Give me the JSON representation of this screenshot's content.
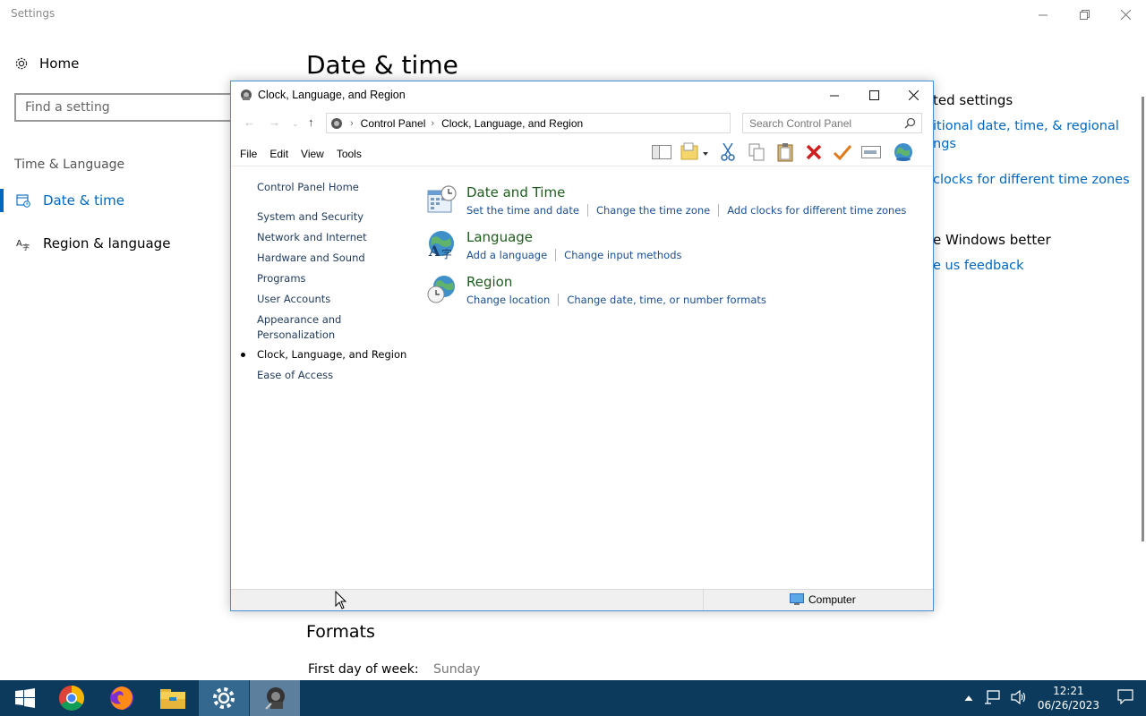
{
  "settings": {
    "window_title": "Settings",
    "home_label": "Home",
    "search_placeholder": "Find a setting",
    "section_label": "Time & Language",
    "nav": [
      {
        "label": "Date & time",
        "icon": "calendar-clock-icon",
        "active": true
      },
      {
        "label": "Region & language",
        "icon": "language-icon",
        "active": false
      }
    ],
    "page_title": "Date & time",
    "related": {
      "heading": "ted settings",
      "links": [
        "itional date, time, & regional",
        "ngs",
        "clocks for different time zones"
      ]
    },
    "better": {
      "heading": "e Windows better",
      "link": "e us feedback"
    },
    "formats": {
      "heading": "Formats",
      "first_day_label": "First day of week:",
      "first_day_value": "Sunday"
    }
  },
  "control_panel": {
    "title": "Clock, Language, and Region",
    "breadcrumb": [
      "Control Panel",
      "Clock, Language, and Region"
    ],
    "search_placeholder": "Search Control Panel",
    "menu": [
      "File",
      "Edit",
      "View",
      "Tools"
    ],
    "sidebar": [
      {
        "label": "Control Panel Home"
      },
      {
        "label": "System and Security"
      },
      {
        "label": "Network and Internet"
      },
      {
        "label": "Hardware and Sound"
      },
      {
        "label": "Programs"
      },
      {
        "label": "User Accounts"
      },
      {
        "label": "Appearance and"
      },
      {
        "label": "Personalization"
      },
      {
        "label": "Clock, Language, and Region",
        "current": true
      },
      {
        "label": "Ease of Access"
      }
    ],
    "categories": [
      {
        "title": "Date and Time",
        "icon": "date-time-icon",
        "links": [
          "Set the time and date",
          "Change the time zone",
          "Add clocks for different time zones"
        ]
      },
      {
        "title": "Language",
        "icon": "language-globe-icon",
        "links": [
          "Add a language",
          "Change input methods"
        ]
      },
      {
        "title": "Region",
        "icon": "region-globe-icon",
        "links": [
          "Change location",
          "Change date, time, or number formats"
        ]
      }
    ],
    "status_text": "Computer"
  },
  "taskbar": {
    "apps": [
      "start-icon",
      "chrome-icon",
      "firefox-icon",
      "file-explorer-icon",
      "settings-icon",
      "control-panel-icon"
    ],
    "time": "12:21",
    "date": "06/26/2023"
  },
  "colors": {
    "accent": "#0067c0",
    "taskbar": "#0c3a5c",
    "cp_link": "#1a4f91",
    "cp_title": "#1e5c1e"
  }
}
